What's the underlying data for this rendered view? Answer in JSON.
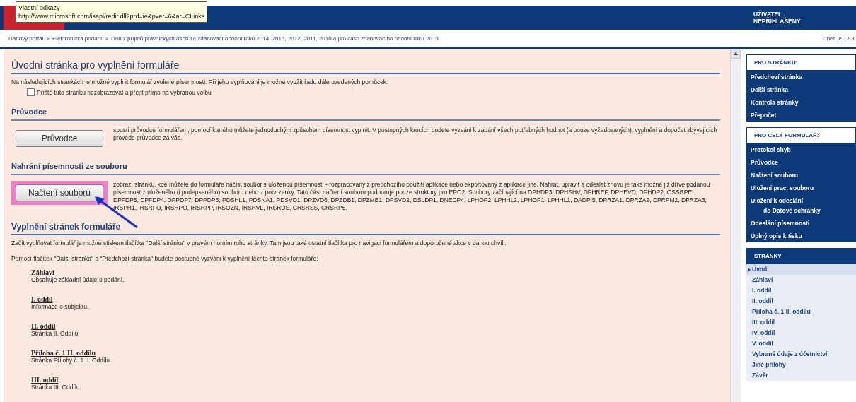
{
  "tooltip": {
    "title": "Vlastní odkazy",
    "url": "http://www.microsoft.com/isapi/redir.dll?prd=ie&pver=6&ar=CLinks"
  },
  "header": {
    "user_label": "UŽIVATEL :",
    "user_value": "NEPŘIHLÁŠENÝ"
  },
  "breadcrumb": {
    "separator": ">",
    "items": [
      "Daňový portál",
      "Elektronická podání",
      "Daň z příjmů právnických osob  za zdaňovací období roků 2014, 2013, 2012, 2011, 2010 a pro části zdaňovacího období roku 2015"
    ],
    "date": "Dnes je 17.3."
  },
  "page_title": "Úvodní stránka pro vyplnění formuláře",
  "intro": "Na následujících stránkách je možné vyplnit formulář zvolené písemnosti. Při jeho vyplňování je možné využít řadu dále uvedených pomůcek.",
  "skip_checkbox": {
    "label": "Příště tuto stránku nezobrazovat a přejít přímo na vybranou volbu",
    "checked": false
  },
  "sections": [
    {
      "heading": "Průvodce",
      "button": "Průvodce",
      "highlighted": false,
      "description": "spustí průvodce formulářem, pomocí kterého můžete jednoduchým způsobem písemnost vyplnit. V postupných krocích budete vyzváni k zadání všech potřebných hodnot (a pouze vyžadovaných), vyplnění a dopočet zbývajících provede průvodce za vás."
    },
    {
      "heading": "Nahrání písemnosti ze souboru",
      "button": "Načtení souboru",
      "highlighted": true,
      "description": "zobrazí stránku, kde můžete do formuláře načíst soubor s uloženou písemností - rozpracovaný z předchozího použití aplikace nebo exportovaný z aplikace jiné. Nahrát, upravit a odeslat znovu je také možné již dříve podanou písemnost z uloženého (i podepsaného) souboru nebo z potvrzenky. Tato část načtení souboru podporuje pouze struktury pro EPO2. Soubory začínající na DPHDP3, DPHSHV, DPHREF, DPHEVD, DPHDP2, OSSRPE, DPFDP5, DPFDP4, DPPDP7, DPPDP6, PDSHL1, PDSNA1, PDSVD1, DPZVD6, DPZDB1, DPZMB1, DPSVD2, DSLDP1, DNEDP4, LPHOP2, LPHHL2, LPHOP1, LPHHL1, DADPI5, DPRZA1, DPRZA2, DPRPM2, DPRZA3, IRSPH1, IRSRFO, IRSRPO, IRSRPP, IRSOZN, IRSRVL, IRSRUS, CRSRSS, CRSRP5."
    }
  ],
  "fill_section": {
    "heading": "Vyplnění stránek formuláře",
    "paragraphs": [
      "Začít vyplňovat formulář je možné stiskem tlačítka \"Další stránka\" v pravém horním rohu stránky. Tam jsou také ostatní tlačítka pro navigaci formulářem a doporučené akce v danou chvíli.",
      "Pomocí tlačítek \"Další stránka\" a \"Předchozí stránka\" budete postupně vyzváni k vyplnění těchto stránek formuláře:"
    ],
    "pages": [
      {
        "title": "Záhlaví",
        "description": "Obsahuje základní údaje o podání."
      },
      {
        "title": "I. oddíl",
        "description": "Informace o subjektu."
      },
      {
        "title": "II. oddíl",
        "description": "Stránka II. Oddílu."
      },
      {
        "title": "Příloha č. 1 II. oddílu",
        "description": "Stránka Přílohy č. 1 II. Oddílu."
      },
      {
        "title": "III. oddíl",
        "description": "Stránka III. Oddílu."
      }
    ]
  },
  "sidebar": {
    "panels": [
      {
        "title": "PRO STRÁNKU:",
        "kind": "actions",
        "items": [
          {
            "label": "Předchozí stránka"
          },
          {
            "label": "Další stránka"
          },
          {
            "label": "Kontrola stránky"
          },
          {
            "label": "Přepočet"
          }
        ]
      },
      {
        "title": "PRO CELÝ FORMULÁŘ:",
        "kind": "actions",
        "items": [
          {
            "label": "Protokol chyb"
          },
          {
            "label": "Průvodce"
          },
          {
            "label": "Načtení souboru"
          },
          {
            "label": "Uložení prac. souboru"
          },
          {
            "label": "Uložení k odeslání",
            "continuation": "do Datové schránky"
          },
          {
            "label": "Odeslání písemnosti"
          },
          {
            "label": "Úplný opis k tisku"
          }
        ]
      },
      {
        "title": "STRÁNKY",
        "kind": "pages",
        "items": [
          {
            "label": "Úvod",
            "selected": true
          },
          {
            "label": "Záhlaví",
            "selected": false
          },
          {
            "label": "I. oddíl",
            "selected": false
          },
          {
            "label": "II. oddíl",
            "selected": false
          },
          {
            "label": "Příloha č. 1 II. oddílu",
            "selected": false
          },
          {
            "label": "III. oddíl",
            "selected": false
          },
          {
            "label": "IV. oddíl",
            "selected": false
          },
          {
            "label": "V. oddíl",
            "selected": false
          },
          {
            "label": "Vybrané údaje z účetnictví",
            "selected": false
          },
          {
            "label": "Jiné přílohy",
            "selected": false
          },
          {
            "label": "Závěr",
            "selected": false
          }
        ]
      }
    ]
  }
}
